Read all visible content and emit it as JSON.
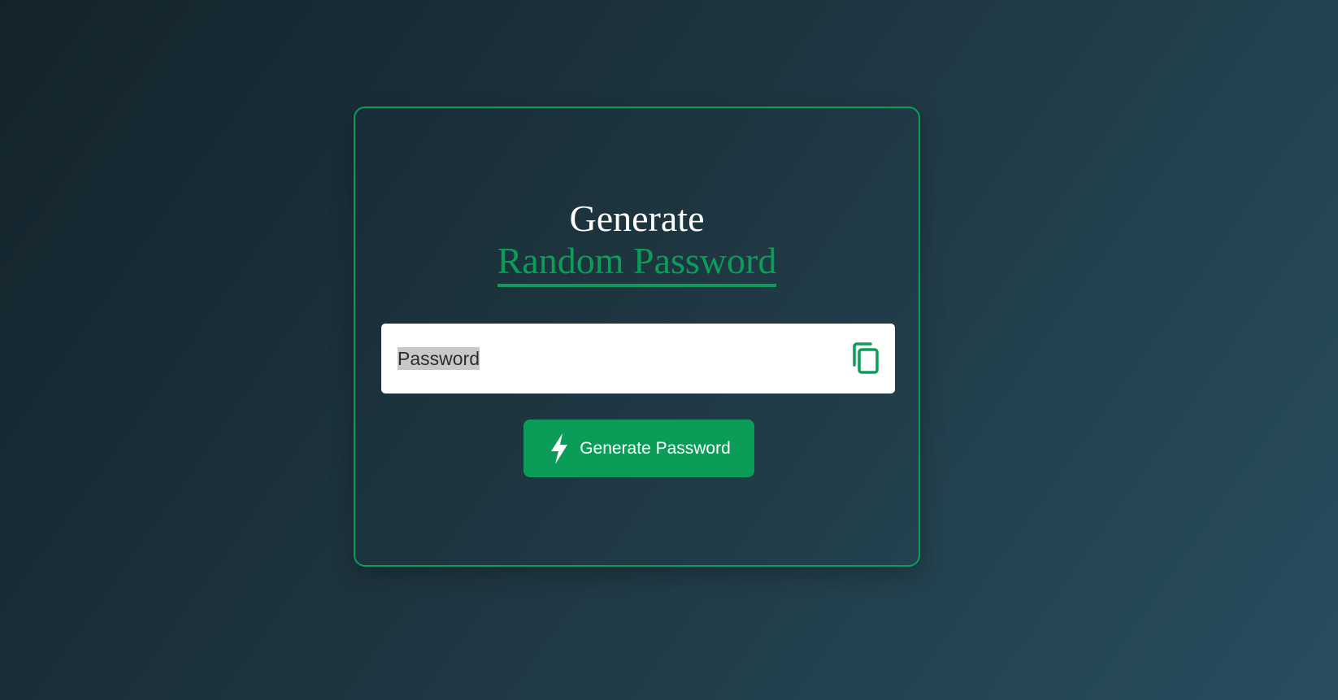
{
  "card": {
    "title_line1": "Generate",
    "title_line2": "Random Password"
  },
  "password_field": {
    "value": "",
    "placeholder": "Password",
    "copy_icon": "copy-icon"
  },
  "generate_button": {
    "label": "Generate Password",
    "icon": "lightning-icon"
  },
  "colors": {
    "accent": "#0b9d58",
    "background_start": "#13232b",
    "background_end": "#284e5e"
  }
}
